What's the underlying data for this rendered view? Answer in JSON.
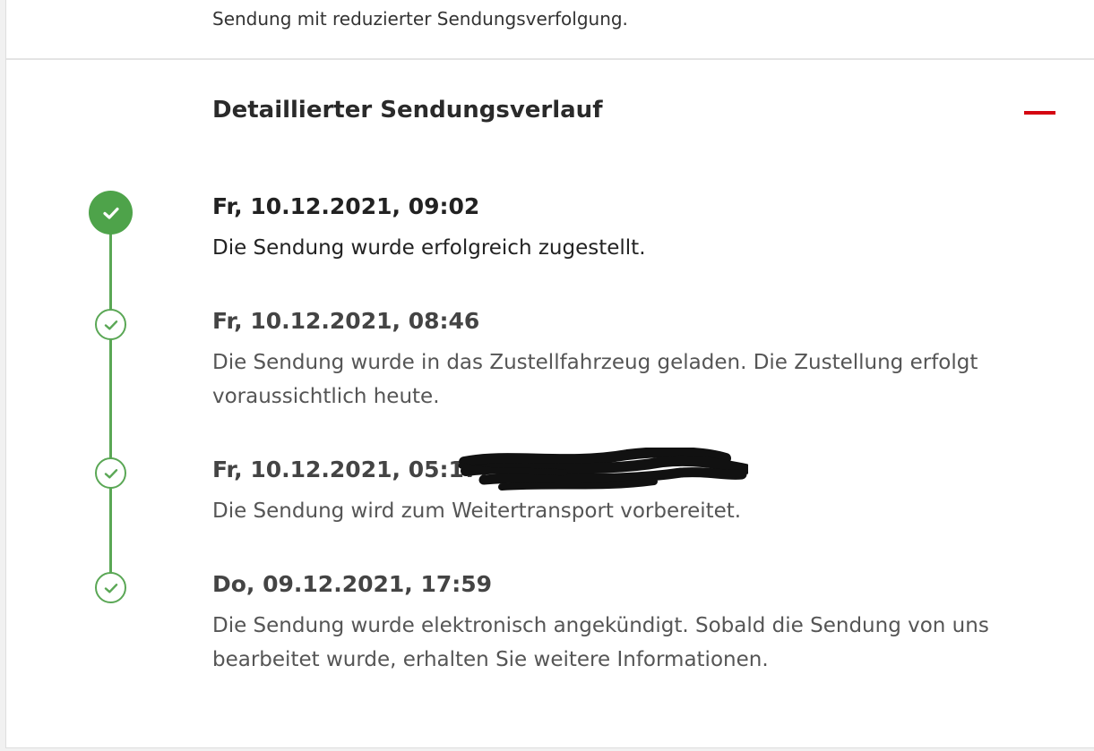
{
  "top_note": "Sendung mit reduzierter Sendungsverfolgung.",
  "section": {
    "title": "Detaillierter Sendungsverlauf",
    "collapse_icon": "minus-icon",
    "accent_color": "#d40511"
  },
  "timeline": {
    "line_color": "#5aa755",
    "events": [
      {
        "timestamp": "Fr, 10.12.2021, 09:02",
        "description": "Die Sendung wurde erfolgreich zugestellt.",
        "icon": "check-filled-icon",
        "status": "completed-latest"
      },
      {
        "timestamp": "Fr, 10.12.2021, 08:46",
        "description": "Die Sendung wurde in das Zustellfahrzeug geladen. Die Zustellung erfolgt voraussichtlich heute.",
        "icon": "check-outline-icon",
        "status": "completed"
      },
      {
        "timestamp": "Fr, 10.12.2021, 05:17,",
        "description": "Die Sendung wird zum Weitertransport vorbereitet.",
        "icon": "check-outline-icon",
        "status": "completed"
      },
      {
        "timestamp": "Do, 09.12.2021, 17:59",
        "description": "Die Sendung wurde elektronisch angekündigt. Sobald die Sendung von uns bearbeitet wurde, erhalten Sie weitere Informationen.",
        "icon": "check-outline-icon",
        "status": "completed"
      }
    ]
  }
}
